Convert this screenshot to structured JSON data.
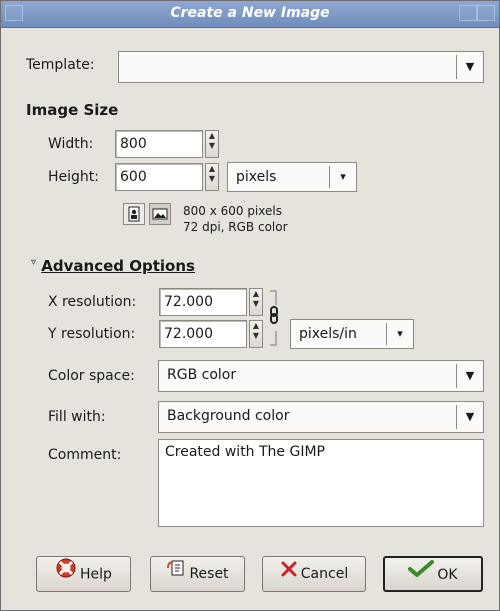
{
  "window": {
    "title": "Create a New Image"
  },
  "template": {
    "label": "Template:",
    "value": ""
  },
  "image_size": {
    "heading": "Image Size",
    "width_label": "Width:",
    "width_value": "800",
    "height_label": "Height:",
    "height_value": "600",
    "unit": "pixels",
    "info_line1": "800 x 600 pixels",
    "info_line2": "72 dpi, RGB color"
  },
  "advanced": {
    "heading": "Advanced Options",
    "x_res_label": "X resolution:",
    "x_res_value": "72.000",
    "y_res_label": "Y resolution:",
    "y_res_value": "72.000",
    "res_unit": "pixels/in",
    "color_space_label": "Color space:",
    "color_space_value": "RGB color",
    "fill_label": "Fill with:",
    "fill_value": "Background color",
    "comment_label": "Comment:",
    "comment_value": "Created with The GIMP"
  },
  "buttons": {
    "help": "Help",
    "reset": "Reset",
    "cancel": "Cancel",
    "ok": "OK"
  },
  "icons": {
    "help": "lifebuoy-icon",
    "reset": "reset-icon",
    "cancel": "x-icon",
    "ok": "checkmark-icon",
    "portrait": "portrait-icon",
    "landscape": "landscape-icon",
    "chain": "chain-icon"
  }
}
